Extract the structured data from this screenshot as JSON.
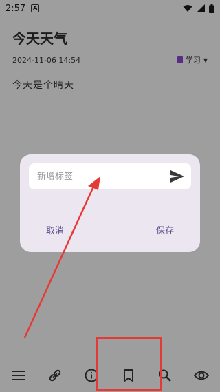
{
  "status": {
    "time": "2:57",
    "app_badge": "A"
  },
  "note": {
    "title": "今天天气",
    "datetime": "2024-11-06 14:54",
    "category": "学习",
    "content": "今天是个晴天"
  },
  "dialog": {
    "input_placeholder": "新增标签",
    "cancel_label": "取消",
    "save_label": "保存"
  },
  "bottom_bar": {
    "icons": [
      "menu-icon",
      "link-icon",
      "info-icon",
      "bookmark-icon",
      "search-icon",
      "eye-icon"
    ]
  },
  "colors": {
    "accent": "#5d4a8a",
    "highlight": "#e53935",
    "category_icon": "#5b2c84"
  }
}
